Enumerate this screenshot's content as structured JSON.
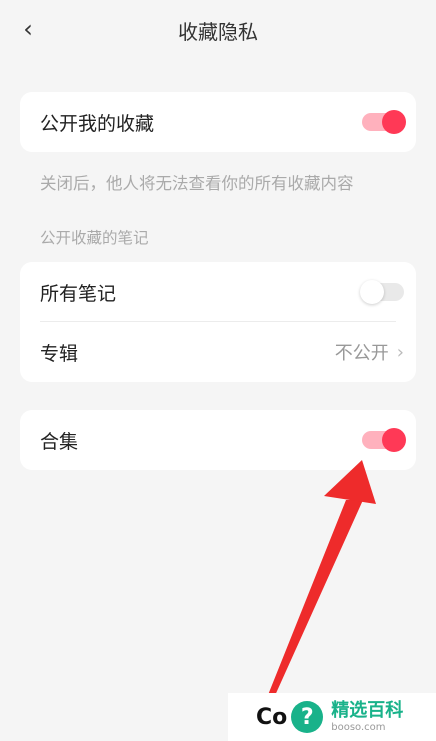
{
  "header": {
    "title": "收藏隐私",
    "back_icon": "chevron-left-icon"
  },
  "public_favorites": {
    "label": "公开我的收藏",
    "enabled": true
  },
  "note": "关闭后，他人将无法查看你的所有收藏内容",
  "section_title": "公开收藏的笔记",
  "all_notes": {
    "label": "所有笔记",
    "enabled": false
  },
  "albums": {
    "label": "专辑",
    "value": "不公开"
  },
  "collections": {
    "label": "合集",
    "enabled": true
  },
  "watermark": {
    "prefix": "Co",
    "badge": "?",
    "brand_cn": "精选百科",
    "brand_url": "booso.com"
  },
  "colors": {
    "toggle_on_knob": "#ff3956",
    "toggle_on_track": "#ffb1bd",
    "arrow": "#ee2b2b",
    "watermark_brand": "#19b28a"
  }
}
